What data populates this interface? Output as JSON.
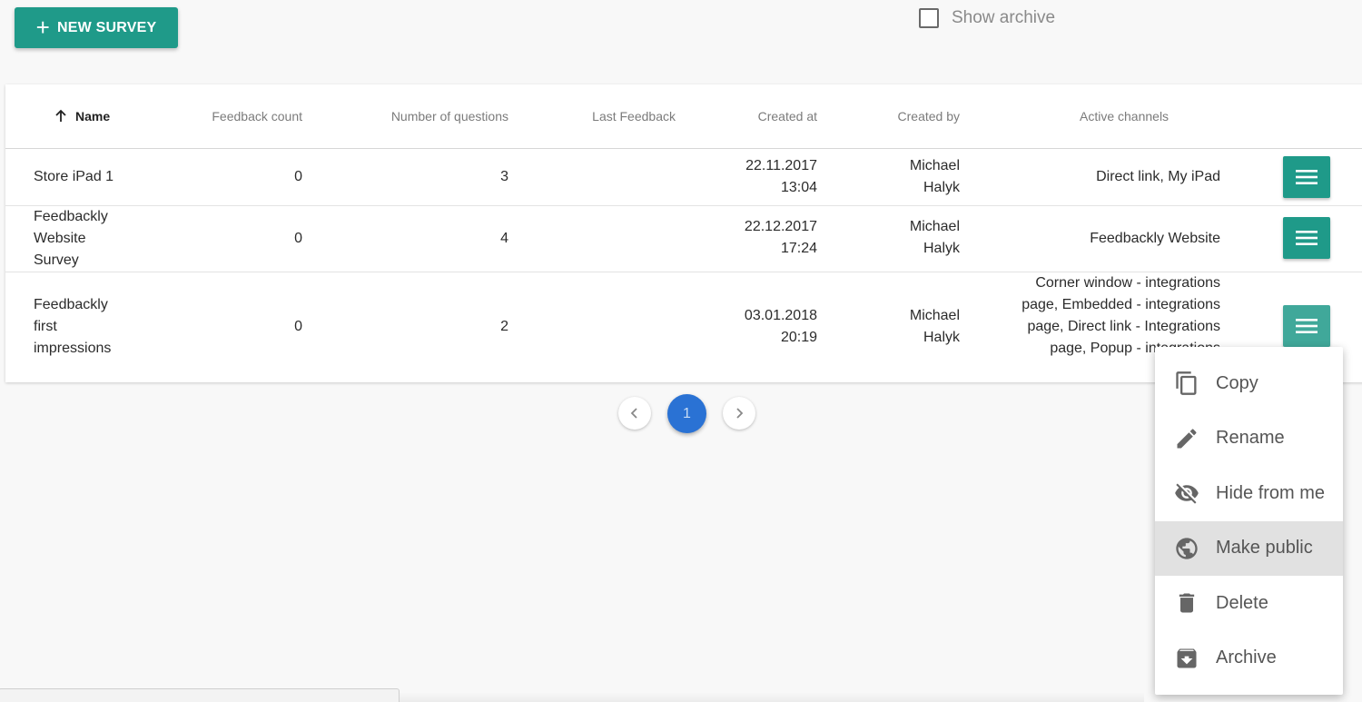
{
  "toolbar": {
    "new_survey_label": "NEW SURVEY",
    "show_archive_label": "Show archive",
    "show_archive_checked": false
  },
  "table": {
    "columns": [
      {
        "key": "name",
        "label": "Name",
        "sorted": "asc"
      },
      {
        "key": "feedback_count",
        "label": "Feedback count"
      },
      {
        "key": "questions",
        "label": "Number of questions"
      },
      {
        "key": "last_feedback",
        "label": "Last Feedback"
      },
      {
        "key": "created_at",
        "label": "Created at"
      },
      {
        "key": "created_by",
        "label": "Created by"
      },
      {
        "key": "channels",
        "label": "Active channels"
      }
    ],
    "rows": [
      {
        "name": "Store iPad 1",
        "feedback_count": "0",
        "questions": "3",
        "last_feedback": "",
        "created_date": "22.11.2017",
        "created_time": "13:04",
        "created_by_first": "Michael",
        "created_by_last": "Halyk",
        "channels": "Direct link, My iPad"
      },
      {
        "name": "Feedbackly Website Survey",
        "feedback_count": "0",
        "questions": "4",
        "last_feedback": "",
        "created_date": "22.12.2017",
        "created_time": "17:24",
        "created_by_first": "Michael",
        "created_by_last": "Halyk",
        "channels": "Feedbackly Website"
      },
      {
        "name": "Feedbackly first impressions",
        "feedback_count": "0",
        "questions": "2",
        "last_feedback": "",
        "created_date": "03.01.2018",
        "created_time": "20:19",
        "created_by_first": "Michael",
        "created_by_last": "Halyk",
        "channels": "Corner window - integrations page, Embedded - integrations page, Direct link - Integrations page, Popup - integrations"
      }
    ]
  },
  "pagination": {
    "current_page": "1"
  },
  "context_menu": {
    "items": [
      {
        "label": "Copy",
        "icon": "copy-icon"
      },
      {
        "label": "Rename",
        "icon": "pencil-icon"
      },
      {
        "label": "Hide from me",
        "icon": "eye-off-icon"
      },
      {
        "label": "Make public",
        "icon": "globe-icon",
        "highlighted": true
      },
      {
        "label": "Delete",
        "icon": "trash-icon"
      },
      {
        "label": "Archive",
        "icon": "archive-icon"
      }
    ]
  },
  "colors": {
    "accent": "#1f9a89",
    "page_active": "#2a72d4",
    "menu_highlight": "#e1e1e1"
  }
}
